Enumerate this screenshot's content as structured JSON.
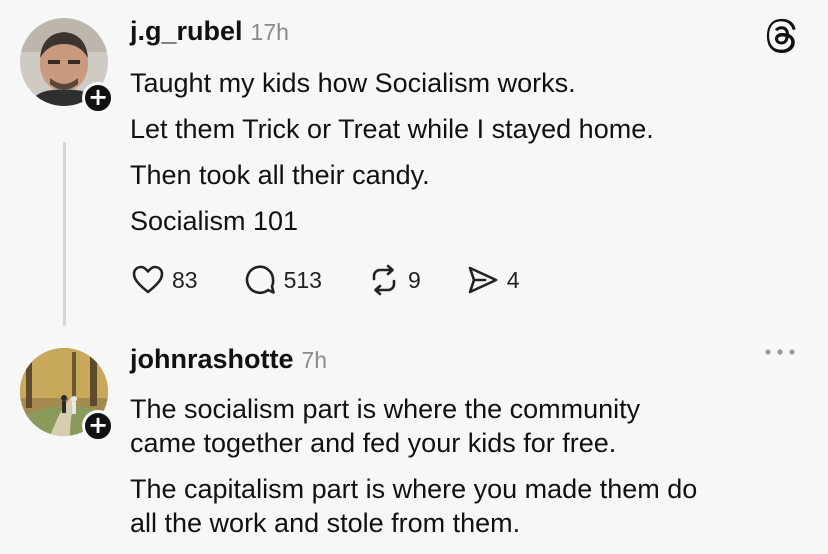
{
  "posts": [
    {
      "username": "j.g_rubel",
      "time": "17h",
      "lines": [
        "Taught my kids how Socialism works.",
        "Let them Trick or Treat while I stayed home.",
        "Then took all their candy.",
        "Socialism 101"
      ],
      "likes": "83",
      "replies": "513",
      "reposts": "9",
      "shares": "4",
      "follow_label": "+",
      "icons": {
        "platform": "threads-logo-icon"
      }
    },
    {
      "username": "johnrashotte",
      "time": "7h",
      "lines": [
        "The socialism part is where the community",
        "came together and fed your kids for free.",
        "The capitalism part is where you made them do",
        "all the work and stole from them."
      ],
      "follow_label": "+",
      "icons": {
        "menu": "more-options-icon"
      }
    }
  ]
}
